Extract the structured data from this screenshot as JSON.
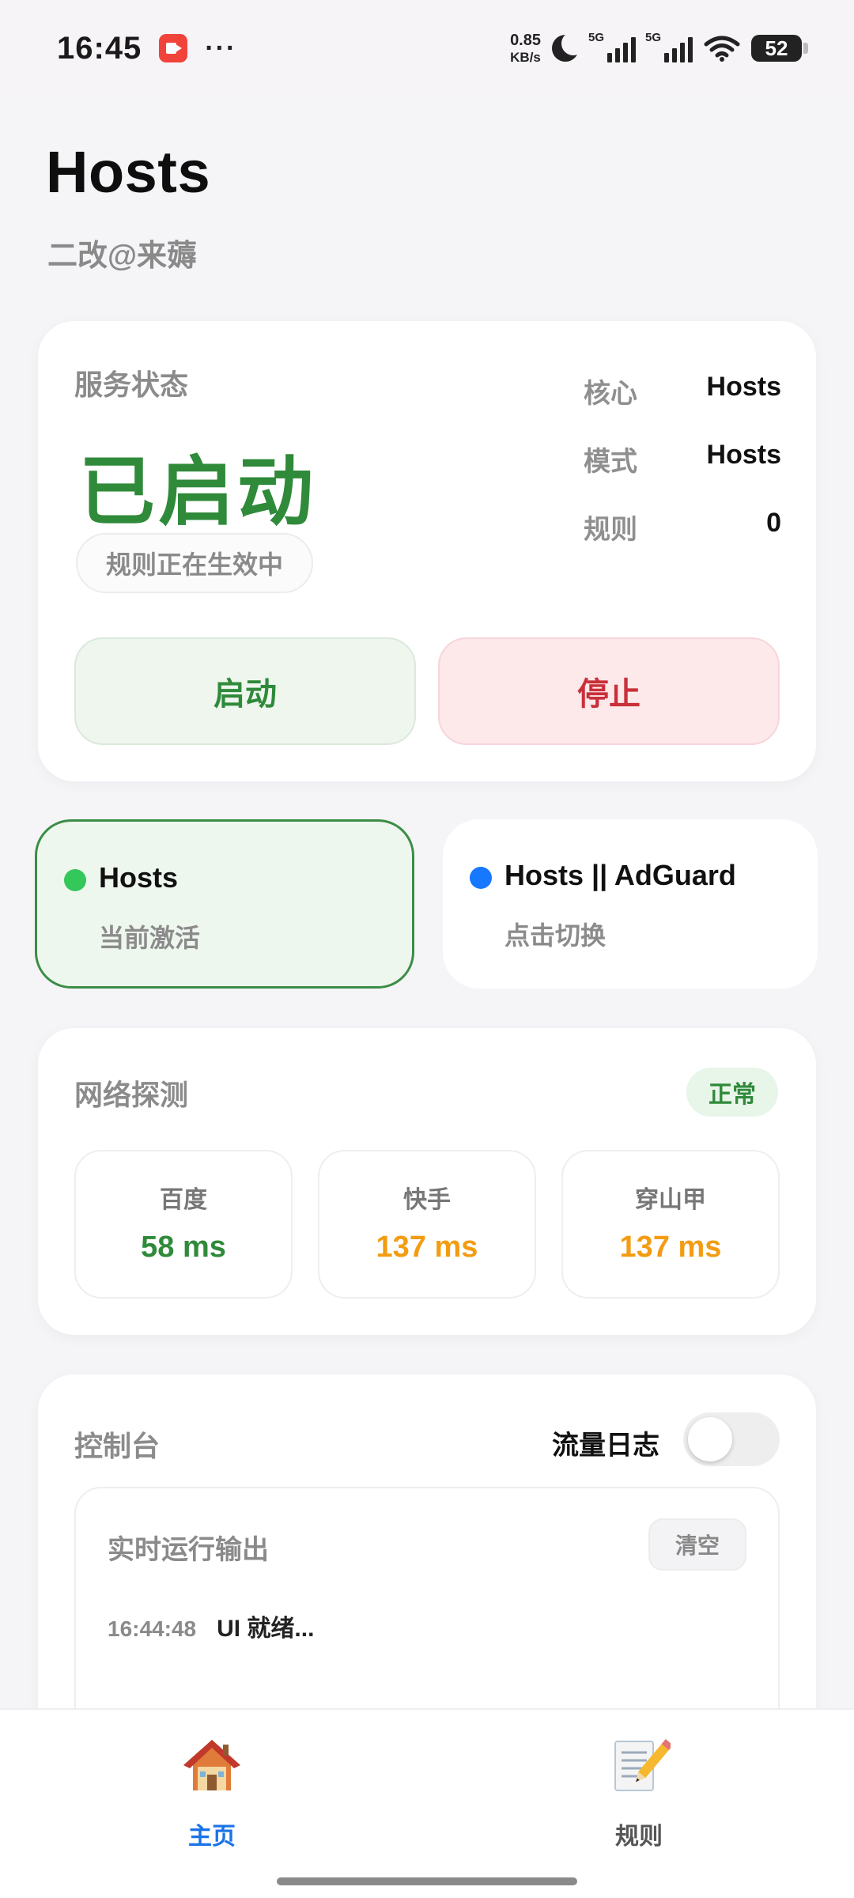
{
  "status_bar": {
    "time": "16:45",
    "more": "···",
    "net_speed_value": "0.85",
    "net_speed_unit": "KB/s",
    "signal1_label": "5G",
    "signal2_label": "5G",
    "battery": "52"
  },
  "header": {
    "title": "Hosts",
    "subtitle": "二改@来薅"
  },
  "service": {
    "label": "服务状态",
    "state": "已启动",
    "chip": "规则正在生效中",
    "info": [
      {
        "key": "核心",
        "value": "Hosts"
      },
      {
        "key": "模式",
        "value": "Hosts"
      },
      {
        "key": "规则",
        "value": "0"
      }
    ],
    "start_label": "启动",
    "stop_label": "停止",
    "colors": {
      "running": "#2f8a3a",
      "stop": "#c8303a"
    }
  },
  "profiles": [
    {
      "name": "Hosts",
      "sub": "当前激活",
      "dot_color": "#34c759",
      "active": true
    },
    {
      "name": "Hosts || AdGuard",
      "sub": "点击切换",
      "dot_color": "#1677ff",
      "active": false
    }
  ],
  "network": {
    "label": "网络探测",
    "badge": "正常",
    "probes": [
      {
        "name": "百度",
        "value": "58 ms",
        "color": "#2f8a3a"
      },
      {
        "name": "快手",
        "value": "137 ms",
        "color": "#f39c12"
      },
      {
        "name": "穿山甲",
        "value": "137 ms",
        "color": "#f39c12"
      }
    ]
  },
  "console": {
    "label": "控制台",
    "toggle_label": "流量日志",
    "toggle_on": false,
    "output_title": "实时运行输出",
    "clear_label": "清空",
    "logs": [
      {
        "time": "16:44:48",
        "message": "UI 就绪..."
      }
    ]
  },
  "nav": {
    "home_label": "主页",
    "rules_label": "规则",
    "home_icon": "house-icon",
    "rules_icon": "memo-pencil-icon",
    "active_color": "#1a73e8"
  }
}
